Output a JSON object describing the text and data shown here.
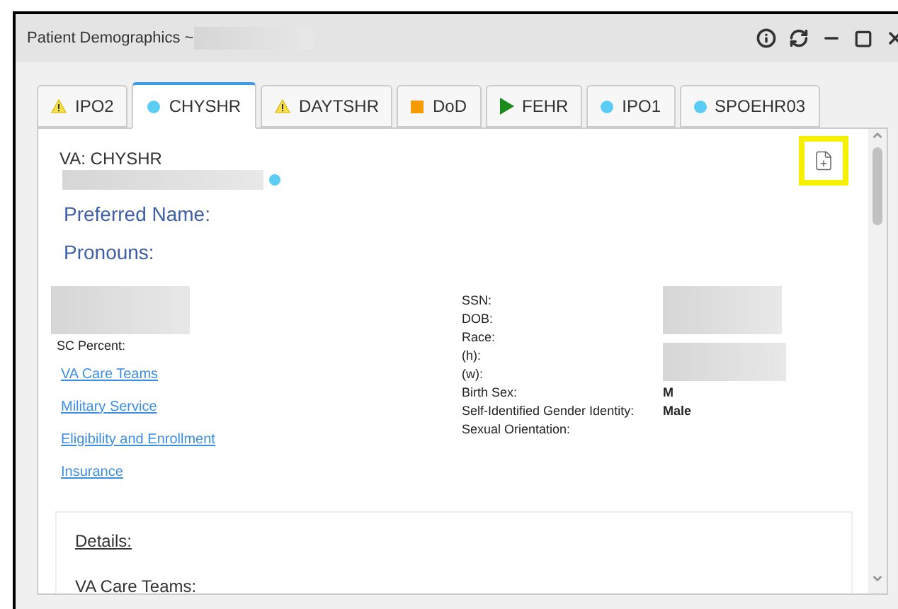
{
  "window": {
    "title": "Patient Demographics ~"
  },
  "tabs": [
    {
      "label": "IPO2",
      "kind": "warning",
      "selected": false
    },
    {
      "label": "CHYSHR",
      "kind": "dot",
      "selected": true
    },
    {
      "label": "DAYTSHR",
      "kind": "warning",
      "selected": false
    },
    {
      "label": "DoD",
      "kind": "square",
      "selected": false
    },
    {
      "label": "FEHR",
      "kind": "play",
      "selected": false
    },
    {
      "label": "IPO1",
      "kind": "dot",
      "selected": false
    },
    {
      "label": "SPOEHR03",
      "kind": "dot",
      "selected": false
    }
  ],
  "panel": {
    "source": "VA: CHYSHR",
    "preferred_name": "Preferred Name:",
    "pronouns": "Pronouns:",
    "sc_percent": "SC Percent:",
    "links": [
      "VA Care Teams",
      "Military Service",
      "Eligibility and Enrollment",
      "Insurance"
    ],
    "fields": [
      {
        "label": "SSN:"
      },
      {
        "label": "DOB:"
      },
      {
        "label": "Race:"
      },
      {
        "label": "(h):"
      },
      {
        "label": "(w):"
      },
      {
        "label": "Birth Sex:",
        "value": "M"
      },
      {
        "label": "Self-Identified Gender Identity:",
        "value": "Male"
      },
      {
        "label": "Sexual Orientation:"
      }
    ],
    "details": {
      "heading": "Details:",
      "subheading": "VA Care Teams:"
    }
  }
}
